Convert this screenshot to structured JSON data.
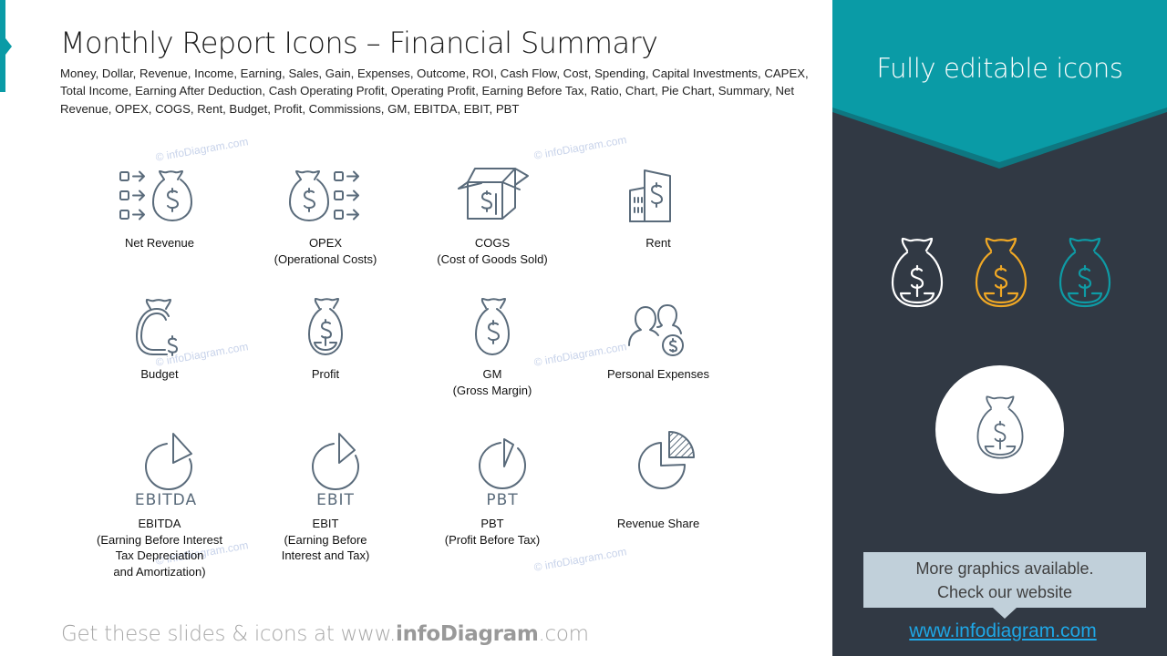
{
  "slide": {
    "title": "Monthly Report Icons – Financial Summary",
    "subtitle": "Money, Dollar, Revenue, Income, Earning, Sales, Gain, Expenses, Outcome, ROI, Cash Flow, Cost, Spending, Capital Investments, CAPEX, Total Income, Earning After Deduction, Cash Operating Profit, Operating Profit, Earning Before Tax, Ratio, Chart, Pie Chart, Summary, Net Revenue, OPEX, COGS, Rent, Budget, Profit, Commissions, GM, EBITDA, EBIT, PBT",
    "watermark": "© infoDiagram.com",
    "accent_color": "#0a9ba6",
    "icon_color": "#5a6b7b"
  },
  "icons": [
    {
      "name": "net-revenue",
      "icon": "money-bag-inflow-icon",
      "label_lines": [
        "Net Revenue"
      ]
    },
    {
      "name": "opex",
      "icon": "money-bag-outflow-icon",
      "label_lines": [
        "OPEX",
        "(Operational Costs)"
      ]
    },
    {
      "name": "cogs",
      "icon": "open-box-dollar-icon",
      "label_lines": [
        "COGS",
        "(Cost of Goods Sold)"
      ]
    },
    {
      "name": "rent",
      "icon": "building-dollar-icon",
      "label_lines": [
        "Rent"
      ]
    },
    {
      "name": "budget",
      "icon": "purse-dollar-icon",
      "label_lines": [
        "Budget"
      ]
    },
    {
      "name": "profit",
      "icon": "money-bag-profit-icon",
      "label_lines": [
        "Profit"
      ]
    },
    {
      "name": "gm",
      "icon": "money-bag-icon",
      "label_lines": [
        "GM",
        "(Gross Margin)"
      ]
    },
    {
      "name": "personal-expenses",
      "icon": "people-coin-icon",
      "label_lines": [
        "Personal Expenses"
      ]
    },
    {
      "name": "ebitda",
      "icon": "pie-chart-icon",
      "abbr": "EBITDA",
      "label_lines": [
        "EBITDA",
        "(Earning Before Interest",
        "Tax Depreciation",
        "and Amortization)"
      ]
    },
    {
      "name": "ebit",
      "icon": "pie-chart-icon",
      "abbr": "EBIT",
      "label_lines": [
        "EBIT",
        "(Earning Before",
        "Interest and Tax)"
      ]
    },
    {
      "name": "pbt",
      "icon": "pie-chart-icon",
      "abbr": "PBT",
      "label_lines": [
        "PBT",
        "(Profit Before Tax)"
      ]
    },
    {
      "name": "revenue-share",
      "icon": "pie-chart-hatched-icon",
      "label_lines": [
        "Revenue Share"
      ]
    }
  ],
  "footer": {
    "prefix": "Get these slides & icons at www.",
    "brand": "infoDiagram",
    "suffix": ".com"
  },
  "side_panel": {
    "header": "Fully editable icons",
    "bag_colors": [
      "#ffffff",
      "#f0a825",
      "#0e9ba5"
    ],
    "callout_line1": "More graphics available.",
    "callout_line2": "Check our website",
    "website": "www.infodiagram.com",
    "colors": {
      "panel": "#313944",
      "header": "#0a9ba6",
      "callout": "#c1d0da",
      "link": "#1ea7e6"
    }
  }
}
